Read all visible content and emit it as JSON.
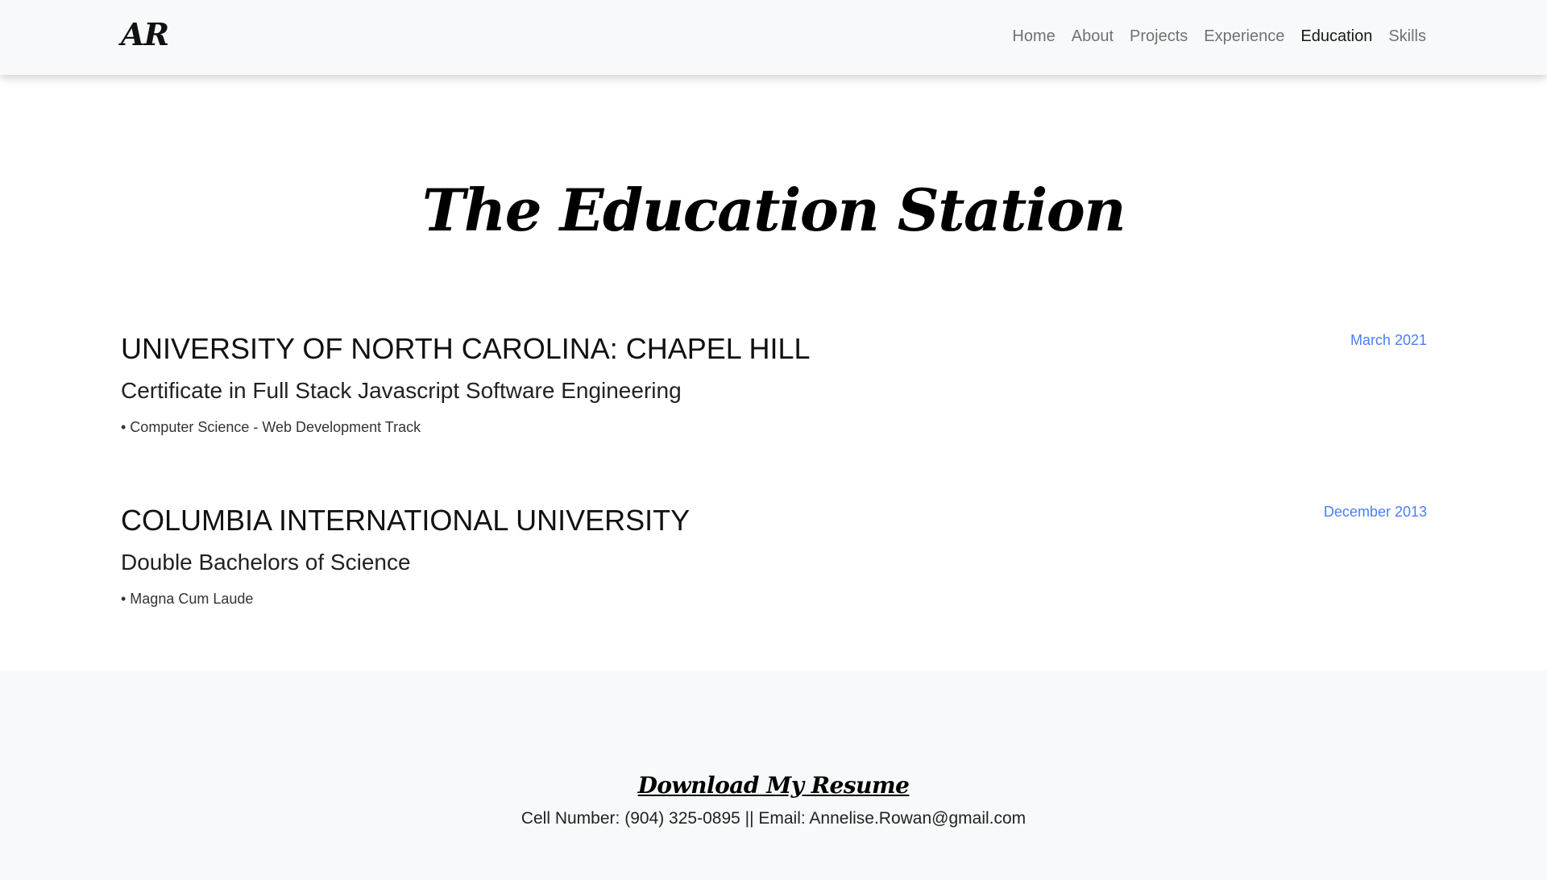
{
  "navbar": {
    "brand": "AR",
    "links": [
      {
        "label": "Home"
      },
      {
        "label": "About"
      },
      {
        "label": "Projects"
      },
      {
        "label": "Experience"
      },
      {
        "label": "Education"
      },
      {
        "label": "Skills"
      }
    ],
    "active_link": "Education"
  },
  "main": {
    "title": "The Education Station",
    "education": [
      {
        "school": "UNIVERSITY OF NORTH CAROLINA: CHAPEL HILL",
        "degree": "Certificate in Full Stack Javascript Software Engineering",
        "detail": "• Computer Science - Web Development Track",
        "date": "March 2021"
      },
      {
        "school": "COLUMBIA INTERNATIONAL UNIVERSITY",
        "degree": "Double Bachelors of Science",
        "detail": "• Magna Cum Laude",
        "date": "December 2013"
      }
    ]
  },
  "footer": {
    "resume_label": "Download My Resume",
    "contact": "Cell Number: (904) 325-0895 || Email: Annelise.Rowan@gmail.com"
  },
  "colors": {
    "accent_date": "#4a7dff",
    "navbar_bg": "#f8f9fa",
    "footer_bg": "#f8f9fa"
  }
}
